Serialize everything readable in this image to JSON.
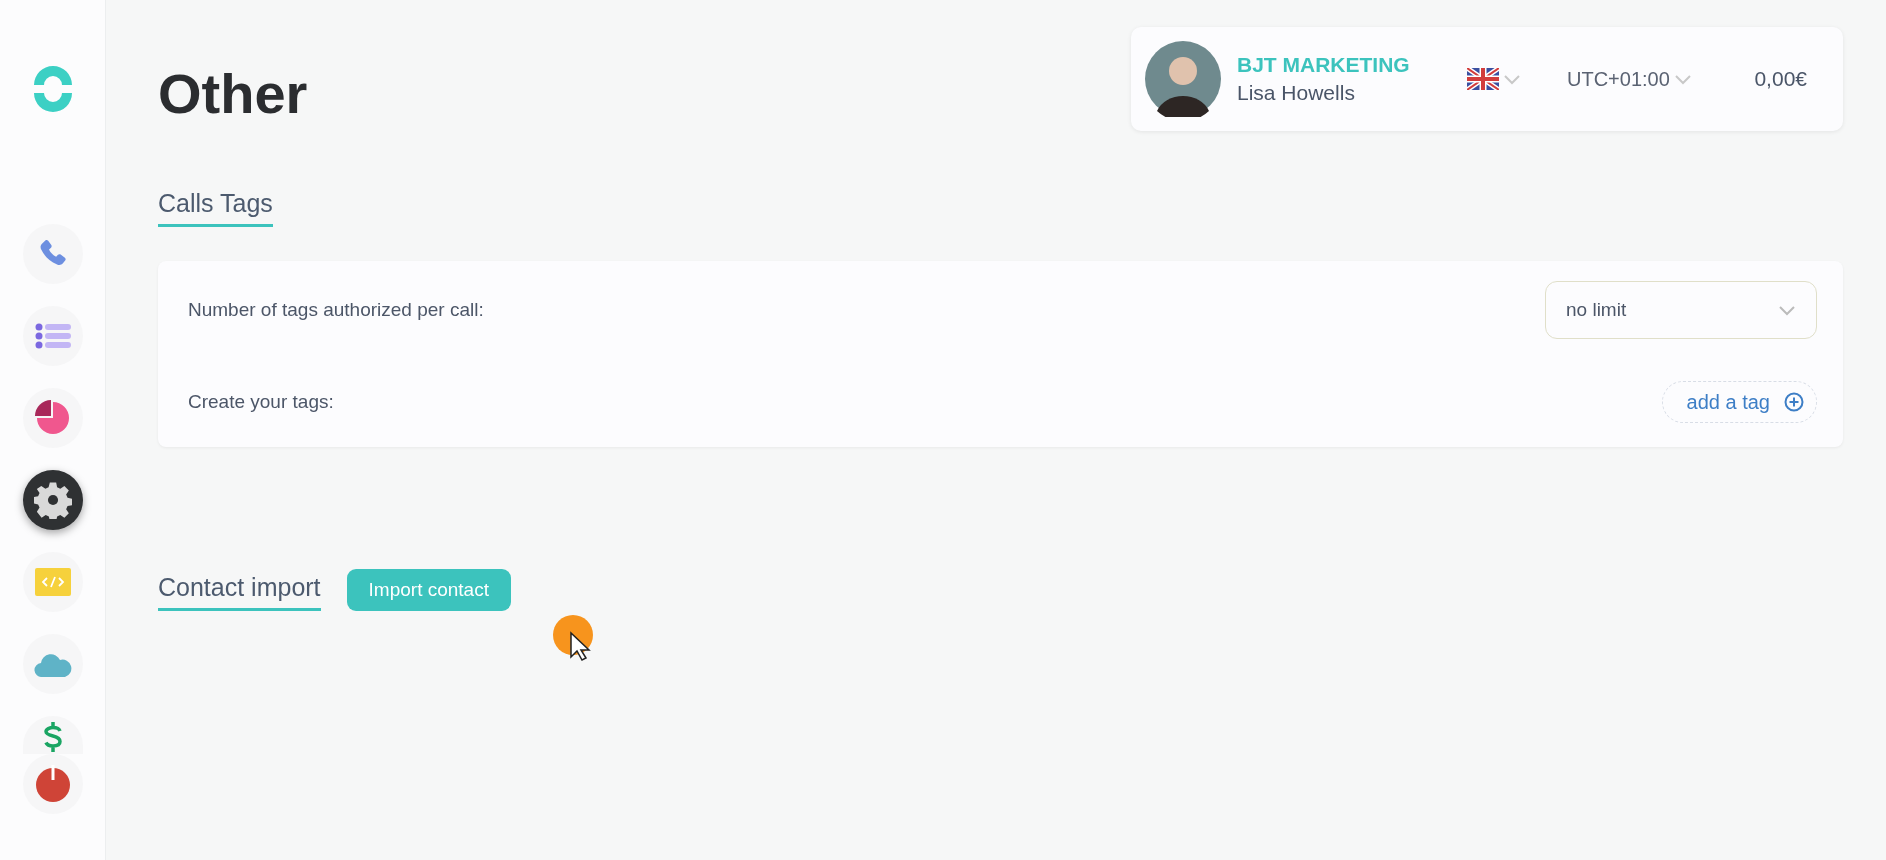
{
  "sidebar": {
    "items": [
      {
        "kind": "phone",
        "selected": false
      },
      {
        "kind": "list",
        "selected": false
      },
      {
        "kind": "chart",
        "selected": false
      },
      {
        "kind": "settings",
        "selected": true
      },
      {
        "kind": "code",
        "selected": false
      },
      {
        "kind": "cloud",
        "selected": false
      },
      {
        "kind": "dollar",
        "selected": false
      },
      {
        "kind": "power",
        "selected": false
      }
    ]
  },
  "page": {
    "title": "Other"
  },
  "account": {
    "company": "BJT MARKETING",
    "user": "Lisa Howells",
    "timezone": "UTC+01:00",
    "balance": "0,00€"
  },
  "calls_tags": {
    "heading": "Calls Tags",
    "rows": [
      {
        "kind": "select",
        "label": "Number of tags authorized per call:",
        "value": "no limit"
      },
      {
        "kind": "add",
        "label": "Create your tags:",
        "action": "add a tag"
      }
    ]
  },
  "contact_import": {
    "heading": "Contact import",
    "button": "Import contact"
  }
}
